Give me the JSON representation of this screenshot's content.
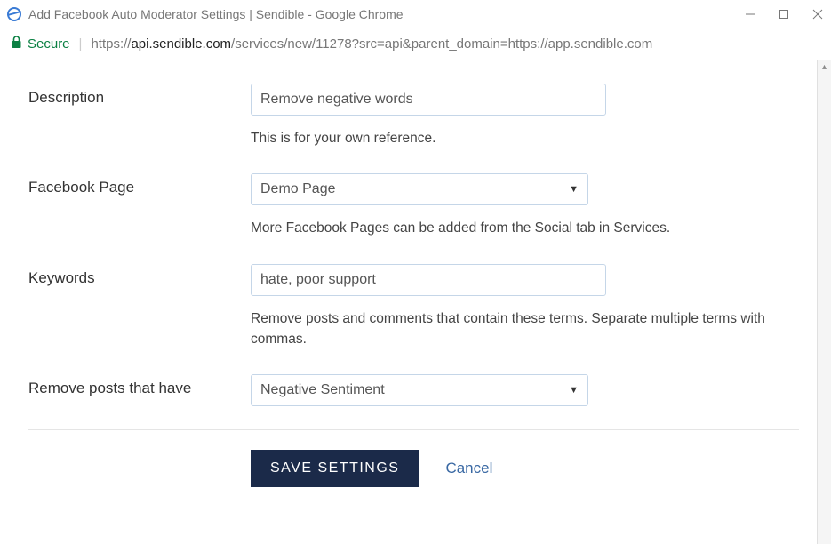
{
  "window": {
    "title": "Add Facebook Auto Moderator Settings | Sendible - Google Chrome"
  },
  "address": {
    "secure_label": "Secure",
    "scheme": "https://",
    "host": "api.sendible.com",
    "path": "/services/new/11278?src=api&parent_domain=https://app.sendible.com"
  },
  "form": {
    "description": {
      "label": "Description",
      "value": "Remove negative words",
      "help": "This is for your own reference."
    },
    "facebook_page": {
      "label": "Facebook Page",
      "selected": "Demo Page",
      "help": "More Facebook Pages can be added from the Social tab in Services."
    },
    "keywords": {
      "label": "Keywords",
      "value": "hate, poor support",
      "help": "Remove posts and comments that contain these terms. Separate multiple terms with commas."
    },
    "remove_posts": {
      "label": "Remove posts that have",
      "selected": "Negative Sentiment"
    }
  },
  "actions": {
    "save_label": "SAVE SETTINGS",
    "cancel_label": "Cancel"
  }
}
